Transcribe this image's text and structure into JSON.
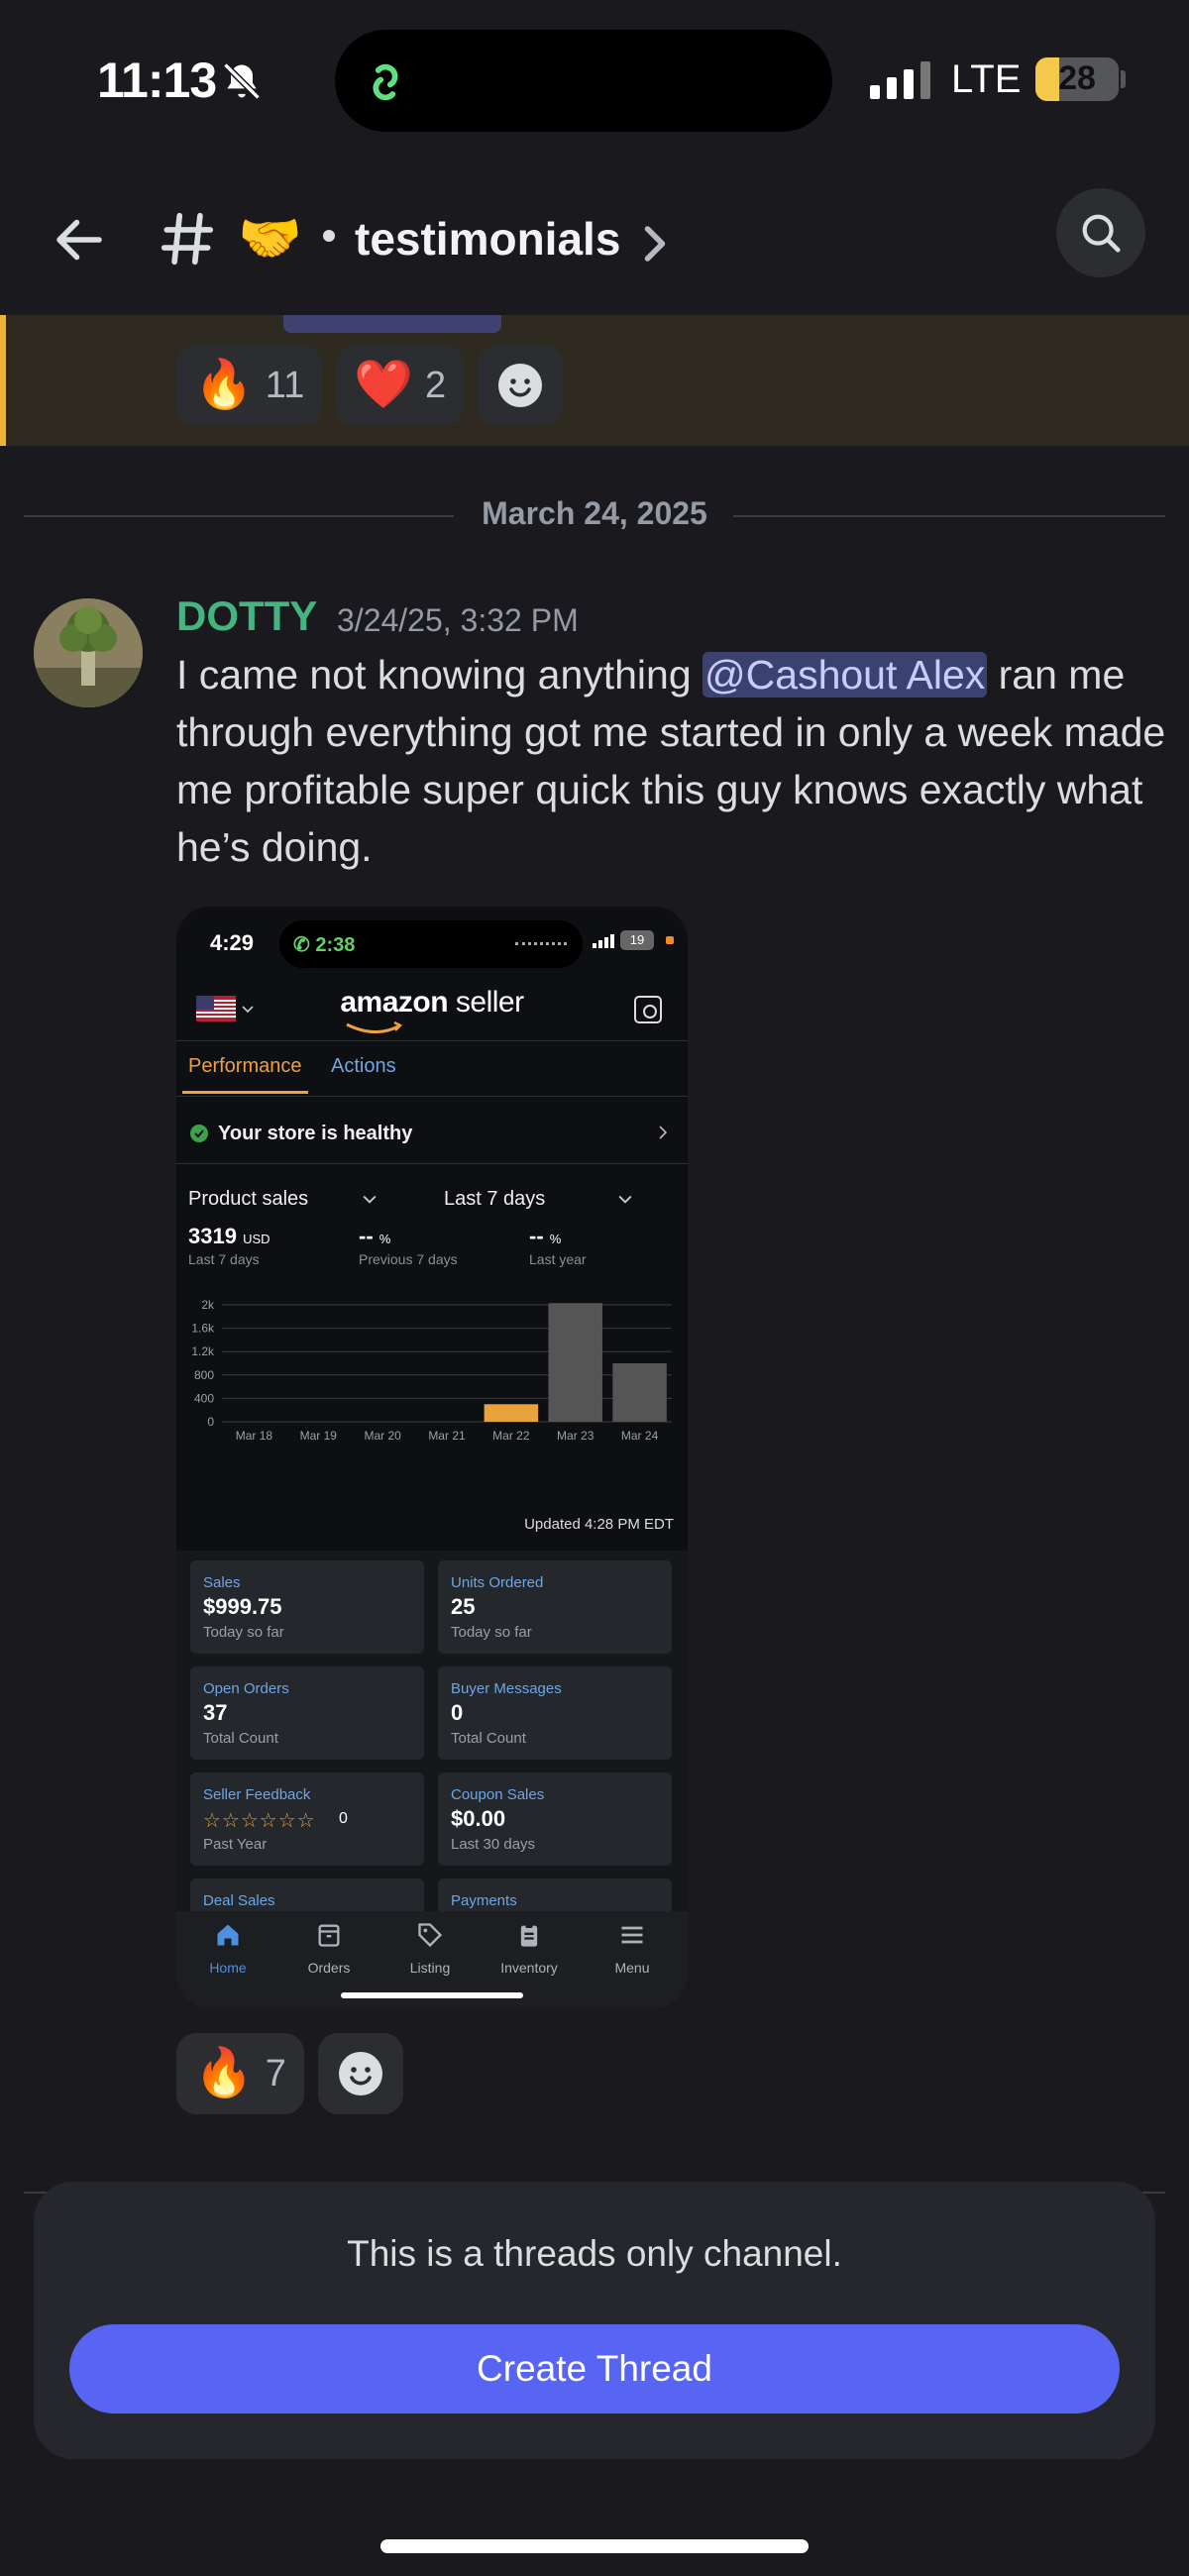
{
  "status_bar": {
    "time": "11:13",
    "network": "LTE",
    "battery": "28"
  },
  "header": {
    "channel_name": "testimonials"
  },
  "previous_message": {
    "reactions": [
      {
        "emoji": "🔥",
        "count": "11"
      },
      {
        "emoji": "❤️",
        "count": "2"
      }
    ]
  },
  "divider": {
    "date": "March 24, 2025"
  },
  "message": {
    "author": "DOTTY",
    "timestamp": "3/24/25, 3:32 PM",
    "text_before": "I came not knowing anything ",
    "mention": "@Cashout Alex",
    "text_after": " ran me through everything got me started in only a week made me profitable super quick this guy knows exactly what he’s doing.",
    "reactions": [
      {
        "emoji": "🔥",
        "count": "7"
      }
    ]
  },
  "screenshot": {
    "status": {
      "time": "4:29",
      "call": "2:38",
      "battery": "19"
    },
    "logo_bold": "amazon",
    "logo_rest": " seller",
    "tabs": [
      "Performance",
      "Actions"
    ],
    "health": "Your store is healthy",
    "selects": [
      "Product sales",
      "Last 7 days"
    ],
    "stats": [
      {
        "value": "3319",
        "unit": "USD",
        "label": "Last 7 days"
      },
      {
        "value": "--",
        "unit": "%",
        "label": "Previous 7 days"
      },
      {
        "value": "--",
        "unit": "%",
        "label": "Last year"
      }
    ],
    "updated": "Updated 4:28 PM EDT",
    "cards": [
      {
        "label": "Sales",
        "value": "$999.75",
        "sub": "Today so far"
      },
      {
        "label": "Units Ordered",
        "value": "25",
        "sub": "Today so far"
      },
      {
        "label": "Open Orders",
        "value": "37",
        "sub": "Total Count"
      },
      {
        "label": "Buyer Messages",
        "value": "0",
        "sub": "Total Count"
      },
      {
        "label": "Seller Feedback",
        "value": "0",
        "sub": "Past Year"
      },
      {
        "label": "Coupon Sales",
        "value": "$0.00",
        "sub": "Last 30 days"
      },
      {
        "label": "Deal Sales",
        "value": "",
        "sub": ""
      },
      {
        "label": "Payments",
        "value": "",
        "sub": ""
      }
    ],
    "nav": [
      "Home",
      "Orders",
      "Listing",
      "Inventory",
      "Menu"
    ],
    "chart_data": {
      "type": "bar",
      "categories": [
        "Mar 18",
        "Mar 19",
        "Mar 20",
        "Mar 21",
        "Mar 22",
        "Mar 23",
        "Mar 24"
      ],
      "values": [
        0,
        0,
        0,
        0,
        300,
        2030,
        1000
      ],
      "highlight_color": "#e8a33d",
      "bar_color": "#555555",
      "y_ticks": [
        "0",
        "400",
        "800",
        "1.2k",
        "1.6k",
        "2k"
      ],
      "ylim": [
        0,
        2000
      ]
    }
  },
  "composer": {
    "notice": "This is a threads only channel.",
    "button": "Create Thread"
  },
  "colors": {
    "accent": "#5865f2",
    "author": "#43b581",
    "highlight": "#f0b232"
  }
}
